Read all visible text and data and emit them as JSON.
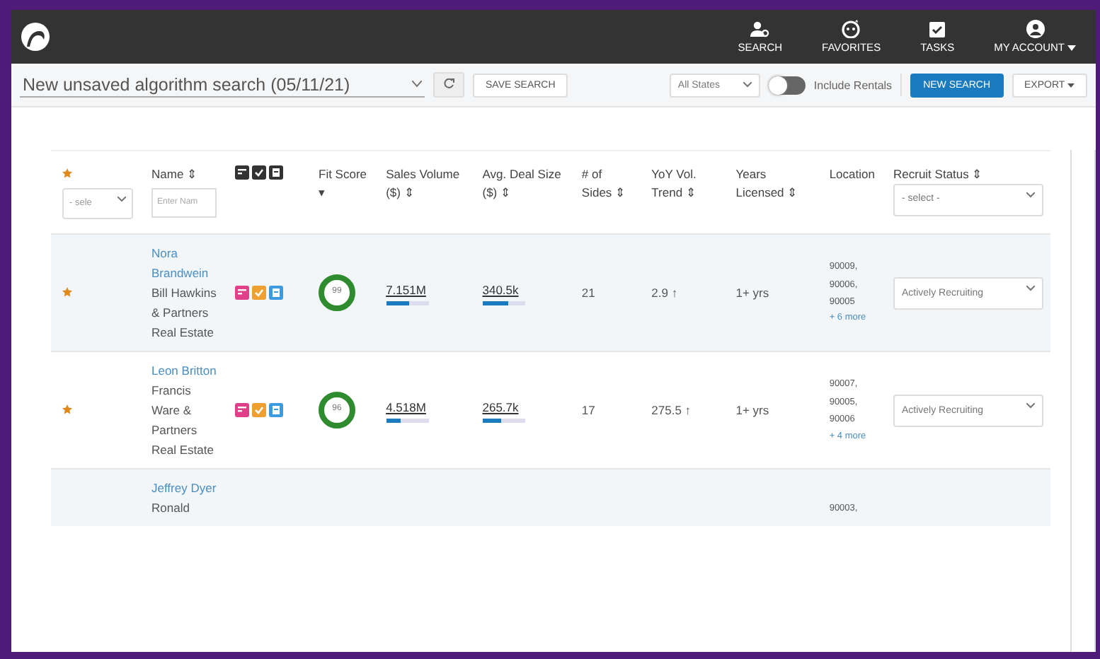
{
  "nav": {
    "items": [
      {
        "kind": "search",
        "label": "SEARCH"
      },
      {
        "kind": "favorites",
        "label": "FAVORITES"
      },
      {
        "kind": "tasks",
        "label": "TASKS"
      },
      {
        "kind": "account",
        "label": "MY ACCOUNT"
      }
    ]
  },
  "toolbar": {
    "search_name": "New unsaved algorithm search (05/11/21)",
    "save_button": "SAVE SEARCH",
    "state_select": "All States",
    "include_rentals": {
      "label": "Include Rentals",
      "on": false
    },
    "new_search_button": "NEW SEARCH",
    "export_button": "EXPORT"
  },
  "table": {
    "star_filter": "- sele",
    "name_placeholder": "Enter Nam",
    "columns": [
      {
        "label": "Name ⇕"
      },
      {
        "label": "Fit Score ▾"
      },
      {
        "label": "Sales Volume ($) ⇕"
      },
      {
        "label": "Avg. Deal Size ($) ⇕"
      },
      {
        "label": "# of Sides ⇕"
      },
      {
        "label": "YoY Vol. Trend ⇕"
      },
      {
        "label": "Years Licensed ⇕"
      },
      {
        "label": "Location"
      },
      {
        "label": "Recruit Status ⇕"
      }
    ],
    "status_filter": "- select -",
    "rows": [
      {
        "starred": true,
        "name": "Nora Brandwein",
        "company": "Bill Hawkins & Partners Real Estate",
        "fit_score": "99",
        "sales_volume": "7.151M",
        "sales_bar": {
          "level": 0.55
        },
        "avg_deal": "340.5k",
        "avg_bar": {
          "level": 0.6
        },
        "sides": "21",
        "yoy": "2.9 ↑",
        "years": "1+ yrs",
        "locations": [
          "90009,",
          "90006,",
          "90005"
        ],
        "more": "+ 6 more",
        "status": "Actively Recruiting"
      },
      {
        "starred": true,
        "name": "Leon Britton",
        "company": "Francis Ware & Partners Real Estate",
        "fit_score": "96",
        "sales_volume": "4.518M",
        "sales_bar": {
          "level": 0.35
        },
        "avg_deal": "265.7k",
        "avg_bar": {
          "level": 0.45
        },
        "sides": "17",
        "yoy": "275.5 ↑",
        "years": "1+ yrs",
        "locations": [
          "90007,",
          "90005,",
          "90006"
        ],
        "more": "+ 4 more",
        "status": "Actively Recruiting"
      },
      {
        "starred": false,
        "name": "Jeffrey Dyer",
        "company": "Ronald",
        "locations": [
          "90003,"
        ]
      }
    ]
  }
}
